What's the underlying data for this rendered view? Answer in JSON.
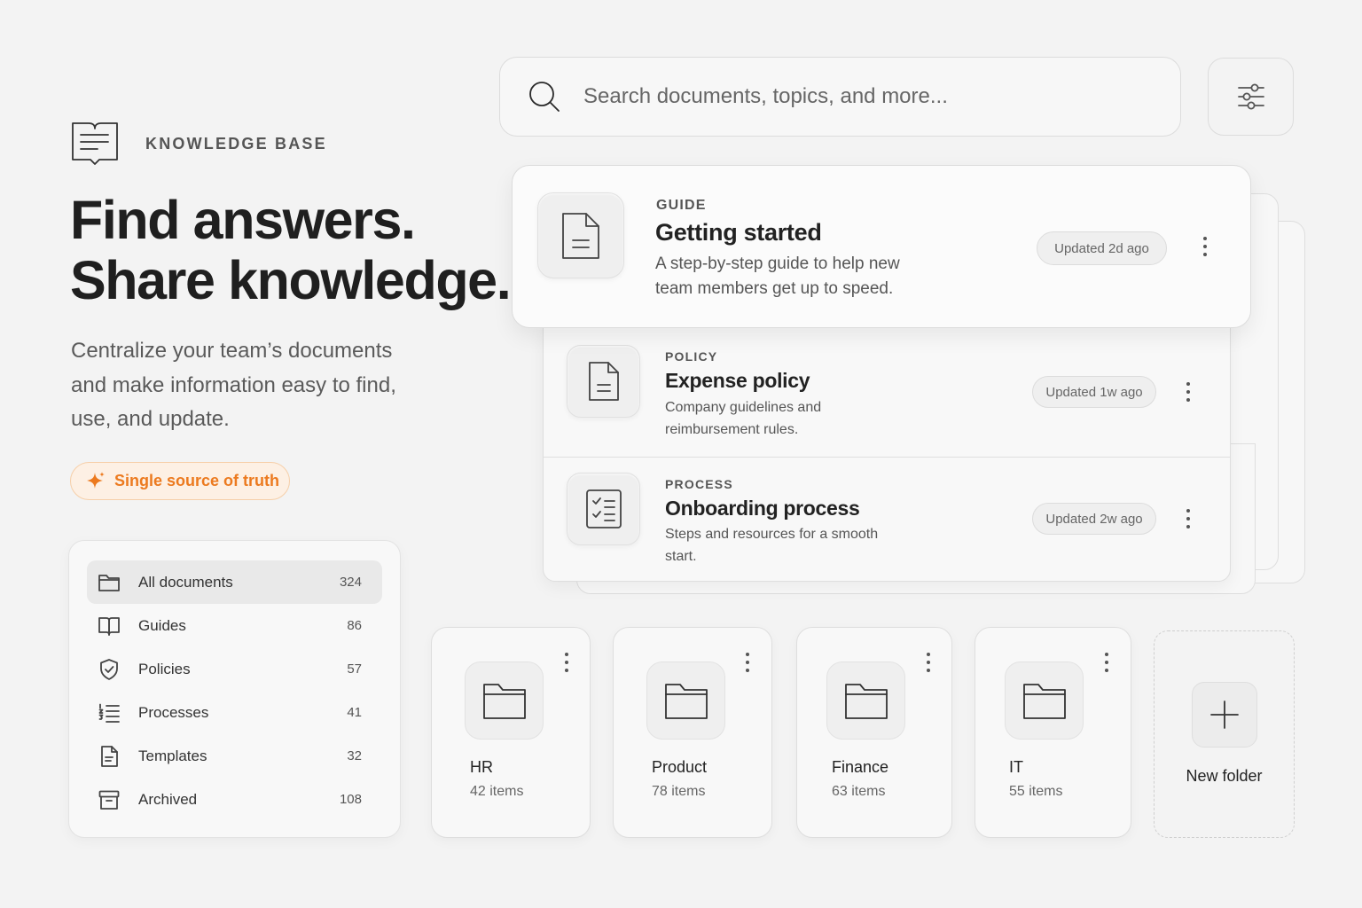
{
  "brand": {
    "label": "KNOWLEDGE BASE",
    "icon": "document-book-icon"
  },
  "hero": {
    "title_line1": "Find answers.",
    "title_line2": "Share knowledge.",
    "description": "Centralize your team’s documents and make information easy to find, use, and update.",
    "pill_label": "Single source of truth",
    "pill_icon": "sparkle-icon",
    "accent_color": "#ec7a1f"
  },
  "nav": {
    "items": [
      {
        "label": "All documents",
        "count": "324",
        "icon": "folder-icon",
        "active": true
      },
      {
        "label": "Guides",
        "count": "86",
        "icon": "book-icon"
      },
      {
        "label": "Policies",
        "count": "57",
        "icon": "shield-check-icon"
      },
      {
        "label": "Processes",
        "count": "41",
        "icon": "list-numbered-icon"
      },
      {
        "label": "Templates",
        "count": "32",
        "icon": "template-file-icon"
      },
      {
        "label": "Archived",
        "count": "108",
        "icon": "archive-icon"
      }
    ]
  },
  "search": {
    "placeholder": "Search documents, topics, and more...",
    "value": ""
  },
  "documents": [
    {
      "category": "GUIDE",
      "title": "Getting started",
      "description_line1": "A step-by-step guide to help new",
      "description_line2": "team members get up to speed.",
      "updated": "Updated 2d ago",
      "icon": "document-icon"
    },
    {
      "category": "POLICY",
      "title": "Expense policy",
      "description_line1": "Company guidelines and",
      "description_line2": "reimbursement rules.",
      "updated": "Updated 1w ago",
      "icon": "document-icon"
    },
    {
      "category": "PROCESS",
      "title": "Onboarding process",
      "description_line1": "Steps and resources for a smooth",
      "description_line2": "start.",
      "updated": "Updated 2w ago",
      "icon": "checklist-icon"
    }
  ],
  "folders": [
    {
      "name": "HR",
      "count": "42 items"
    },
    {
      "name": "Product",
      "count": "78 items"
    },
    {
      "name": "Finance",
      "count": "63 items"
    },
    {
      "name": "IT",
      "count": "55 items"
    }
  ],
  "new_folder": {
    "label": "New folder"
  }
}
